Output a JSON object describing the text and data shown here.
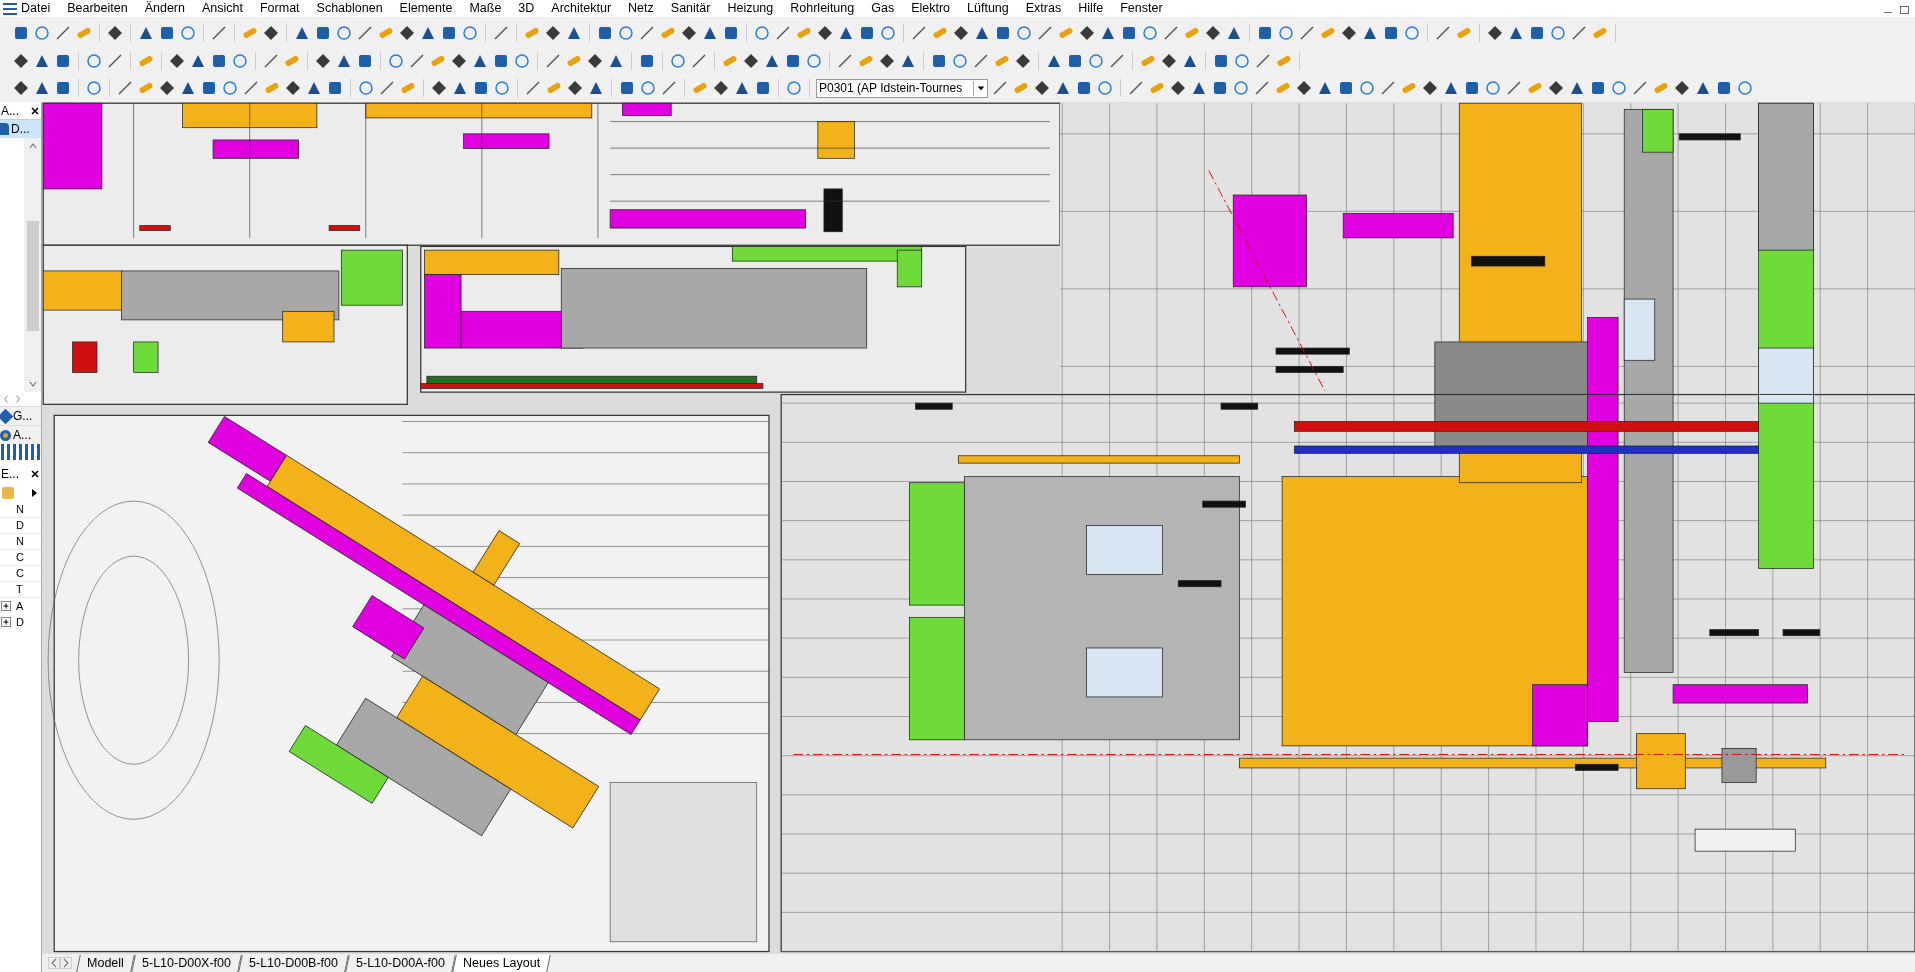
{
  "menu": [
    "Datei",
    "Bearbeiten",
    "Ändern",
    "Ansicht",
    "Format",
    "Schablonen",
    "Elemente",
    "Maße",
    "3D",
    "Architektur",
    "Netz",
    "Sanitär",
    "Heizung",
    "Rohrleitung",
    "Gas",
    "Elektro",
    "Lüftung",
    "Extras",
    "Hilfe",
    "Fenster"
  ],
  "project_select": {
    "value": "P0301 (AP Idstein-Tournes"
  },
  "left_panel": {
    "panel_1": {
      "title": "A...",
      "items": [
        {
          "label": "D...",
          "selected": true
        }
      ]
    },
    "panel_2": {
      "items": [
        {
          "label": "G..."
        },
        {
          "label": "A..."
        }
      ]
    },
    "panel_3": {
      "title": "E...",
      "property_rows": [
        "N",
        "D",
        "N",
        "C",
        "C",
        "T"
      ],
      "tree": [
        {
          "label": "A",
          "expanded": false
        },
        {
          "label": "D",
          "expanded": false
        }
      ]
    }
  },
  "layout_tabs": [
    {
      "label": "Modell",
      "selected": false
    },
    {
      "label": "5-L10-D00X-f00",
      "selected": false
    },
    {
      "label": "5-L10-D00B-f00",
      "selected": false
    },
    {
      "label": "5-L10-D00A-f00",
      "selected": false
    },
    {
      "label": "Neues Layout",
      "selected": true
    }
  ]
}
